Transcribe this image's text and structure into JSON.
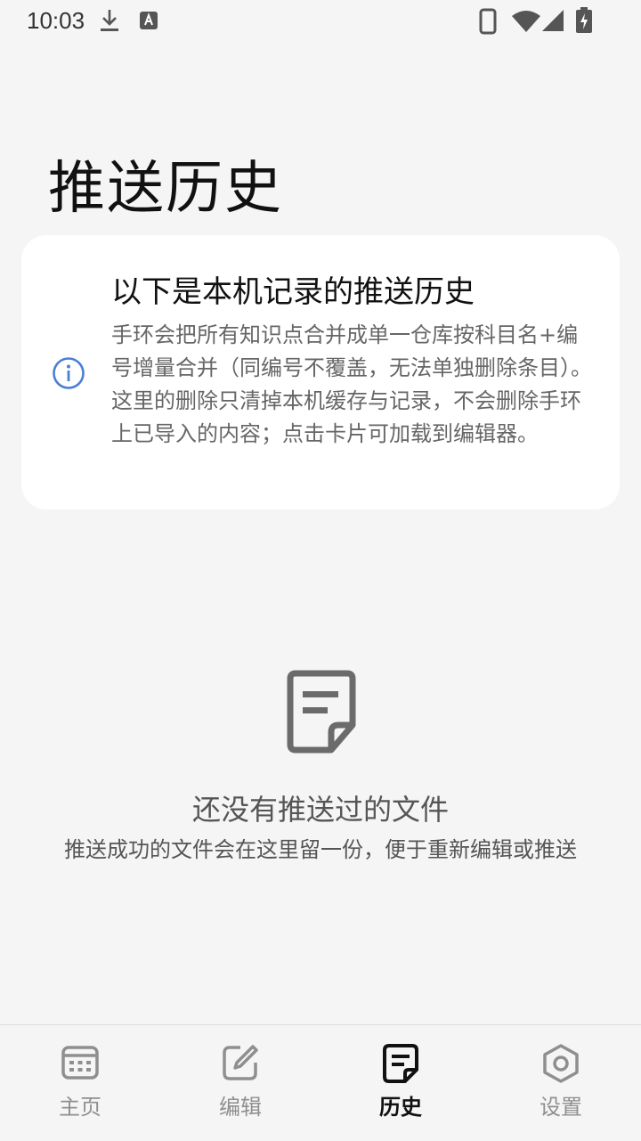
{
  "status_bar": {
    "time": "10:03",
    "icons": [
      "download-icon",
      "app-notification-icon",
      "phone-icon",
      "wifi-icon",
      "signal-icon",
      "battery-charging-icon"
    ]
  },
  "page": {
    "title": "推送历史"
  },
  "info_card": {
    "icon": "info-icon",
    "heading": "以下是本机记录的推送历史",
    "body": "手环会把所有知识点合并成单一仓库按科目名+编号增量合并（同编号不覆盖，无法单独删除条目）。这里的删除只清掉本机缓存与记录，不会删除手环上已导入的内容；点击卡片可加载到编辑器。"
  },
  "empty_state": {
    "icon": "document-icon",
    "title": "还没有推送过的文件",
    "subtitle": "推送成功的文件会在这里留一份，便于重新编辑或推送"
  },
  "bottom_nav": {
    "items": [
      {
        "label": "主页",
        "icon": "calendar-icon",
        "active": false
      },
      {
        "label": "编辑",
        "icon": "edit-icon",
        "active": false
      },
      {
        "label": "历史",
        "icon": "history-document-icon",
        "active": true
      },
      {
        "label": "设置",
        "icon": "settings-icon",
        "active": false
      }
    ]
  },
  "colors": {
    "background": "#f5f5f5",
    "card": "#ffffff",
    "info_accent": "#4a7fd4",
    "nav_inactive": "#8f8f8f",
    "nav_active": "#111111"
  }
}
